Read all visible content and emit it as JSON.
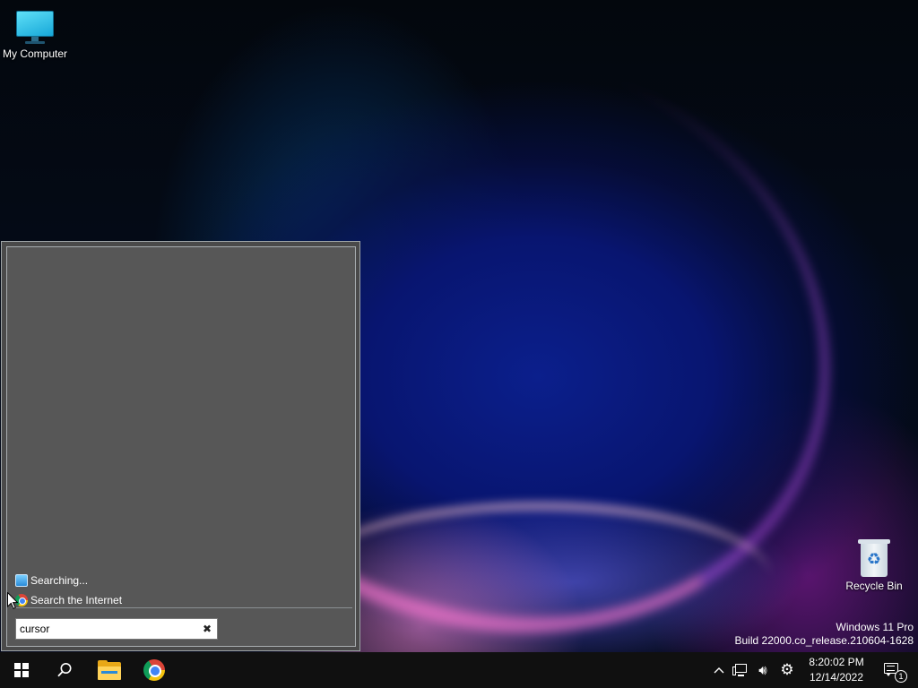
{
  "desktop": {
    "icons": [
      {
        "label": "My Computer",
        "icon": "monitor-icon"
      },
      {
        "label": "Recycle Bin",
        "icon": "recycle-bin-icon"
      }
    ],
    "watermark": {
      "line1": "Windows 11 Pro",
      "line2": "Build 22000.co_release.210604-1628"
    }
  },
  "start_menu": {
    "results": [
      {
        "label": "Searching...",
        "icon": "search-progress-icon"
      },
      {
        "label": "Search the Internet",
        "icon": "chrome-icon"
      }
    ],
    "search": {
      "value": "cursor",
      "clear_icon": "close-icon"
    }
  },
  "taskbar": {
    "buttons": [
      {
        "name": "start",
        "icon": "windows-logo-icon"
      },
      {
        "name": "search",
        "icon": "search-icon"
      },
      {
        "name": "file-explorer",
        "icon": "folder-icon"
      },
      {
        "name": "chrome",
        "icon": "chrome-icon"
      }
    ],
    "tray": {
      "icons": [
        "chevron-up-icon",
        "network-icon",
        "volume-icon",
        "gear-icon"
      ],
      "clock": {
        "time": "8:20:02 PM",
        "date": "12/14/2022"
      },
      "notifications": {
        "count": "1",
        "icon": "notification-center-icon"
      }
    }
  },
  "colors": {
    "taskbar": "#101010",
    "start_menu_bg": "#4a4a4a",
    "start_menu_inner": "#575757"
  }
}
